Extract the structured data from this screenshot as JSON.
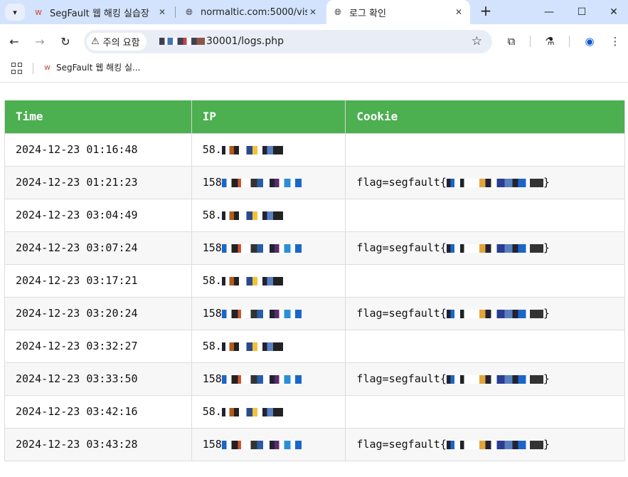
{
  "browser": {
    "tabs": [
      {
        "title": "SegFault 웹 해킹 실습장",
        "active": false
      },
      {
        "title": "normaltic.com:5000/visit_",
        "active": false
      },
      {
        "title": "로그 확인",
        "active": true
      }
    ],
    "new_tab_icon": "plus-icon",
    "security_chip": "주의 요함",
    "url_visible": "30001/logs.php",
    "bookmark_label": "SegFault 웹 해킹 실...",
    "accent_color": "#d3e3fd"
  },
  "table": {
    "header_color": "#4caf50",
    "columns": [
      "Time",
      "IP",
      "Cookie"
    ],
    "rows": [
      {
        "time": "2024-12-23 01:16:48",
        "ip": "58.",
        "cookie": ""
      },
      {
        "time": "2024-12-23 01:21:23",
        "ip": "158",
        "cookie": "flag=segfault{"
      },
      {
        "time": "2024-12-23 03:04:49",
        "ip": "58.",
        "cookie": ""
      },
      {
        "time": "2024-12-23 03:07:24",
        "ip": "158",
        "cookie": "flag=segfault{"
      },
      {
        "time": "2024-12-23 03:17:21",
        "ip": "58.",
        "cookie": ""
      },
      {
        "time": "2024-12-23 03:20:24",
        "ip": "158",
        "cookie": "flag=segfault{"
      },
      {
        "time": "2024-12-23 03:32:27",
        "ip": "58.",
        "cookie": ""
      },
      {
        "time": "2024-12-23 03:33:50",
        "ip": "158",
        "cookie": "flag=segfault{"
      },
      {
        "time": "2024-12-23 03:42:16",
        "ip": "58.",
        "cookie": ""
      },
      {
        "time": "2024-12-23 03:43:28",
        "ip": "158",
        "cookie": "flag=segfault{"
      }
    ],
    "cookie_close": "}"
  }
}
